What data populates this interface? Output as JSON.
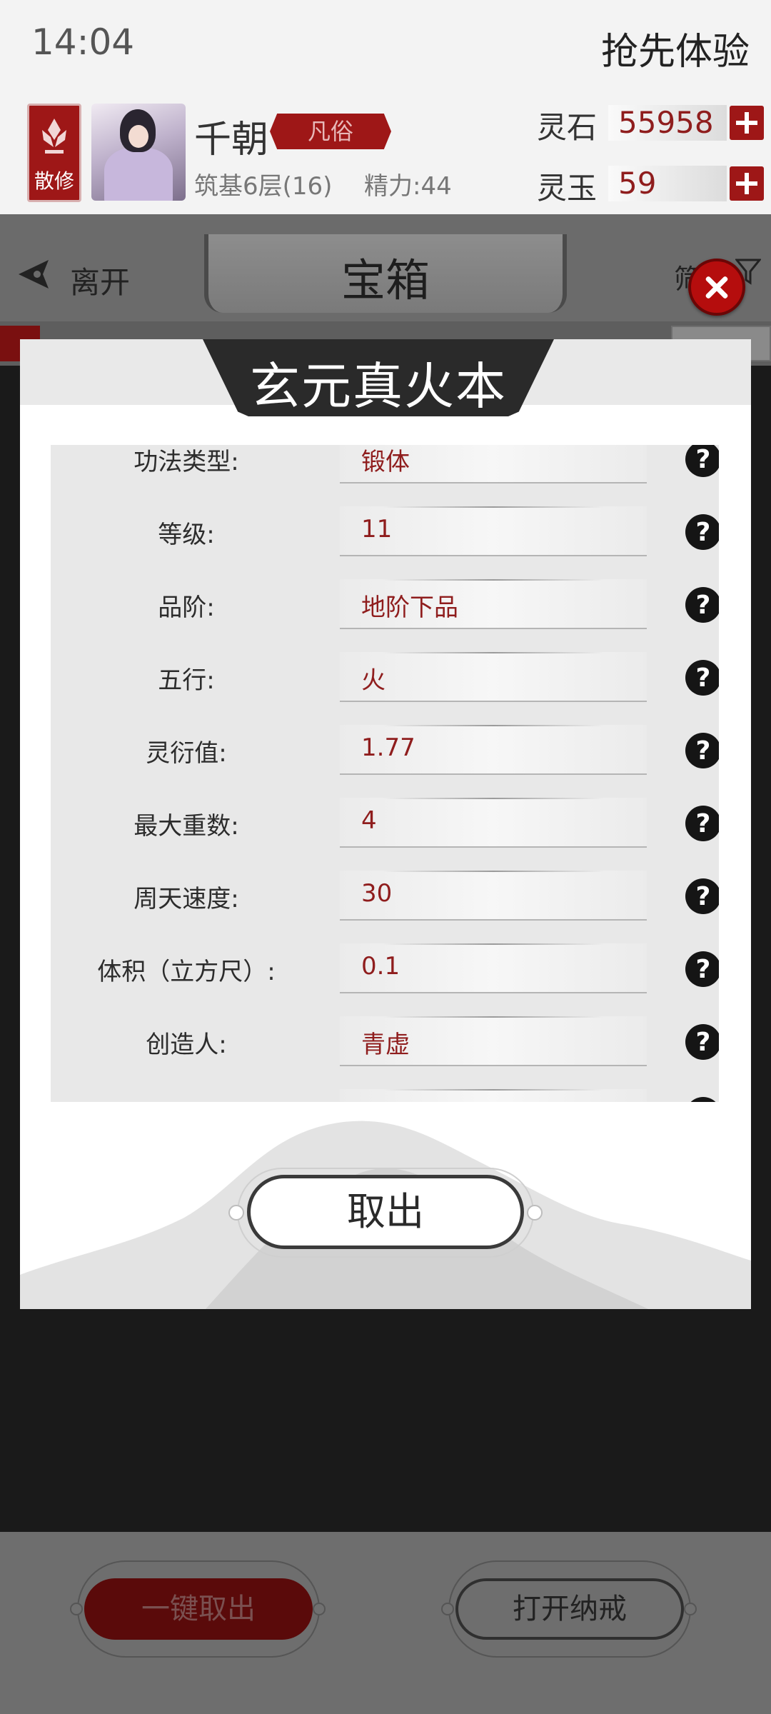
{
  "status_bar": {
    "time": "14:04",
    "promo": "抢先体验"
  },
  "player": {
    "sect_label": "散修",
    "name": "千朝",
    "rank": "凡俗",
    "realm": "筑基6层(16)",
    "energy": "精力:44",
    "resources": [
      {
        "label": "灵石",
        "value": "55958"
      },
      {
        "label": "灵玉",
        "value": "59"
      }
    ]
  },
  "nav": {
    "back_label": "离开",
    "title": "宝箱",
    "filter_label": "筛"
  },
  "modal": {
    "title": "玄元真火本",
    "properties": [
      {
        "label": "功法类型:",
        "value": "锻体"
      },
      {
        "label": "等级:",
        "value": "11"
      },
      {
        "label": "品阶:",
        "value": "地阶下品"
      },
      {
        "label": "五行:",
        "value": "火"
      },
      {
        "label": "灵衍值:",
        "value": "1.77"
      },
      {
        "label": "最大重数:",
        "value": "4"
      },
      {
        "label": "周天速度:",
        "value": "30"
      },
      {
        "label": "体积（立方尺）:",
        "value": "0.1"
      },
      {
        "label": "创造人:",
        "value": "青虚"
      }
    ],
    "take_out_label": "取出"
  },
  "bottom": {
    "take_all_label": "一键取出",
    "open_ring_label": "打开纳戒"
  },
  "colors": {
    "accent_red": "#9e1717",
    "value_red": "#8f1d1d",
    "overlay": "#1a1a1a"
  }
}
